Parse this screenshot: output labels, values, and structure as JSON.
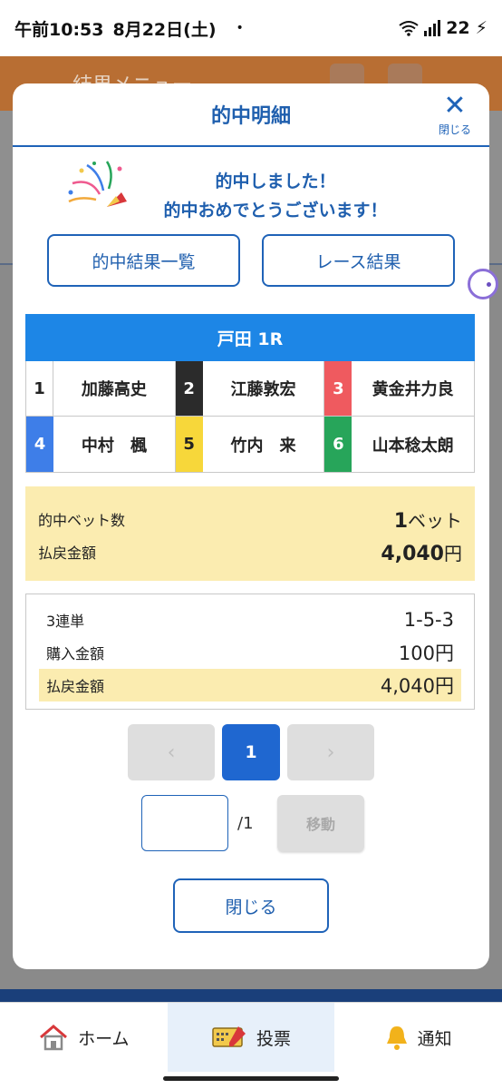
{
  "status_bar": {
    "time": "午前10:53",
    "date": "8月22日(土)",
    "dot": "•",
    "battery": "22"
  },
  "background": {
    "menu_title": "結果メニュー",
    "brand_color": "#b86e33"
  },
  "modal": {
    "title": "的中明細",
    "close_label": "閉じる",
    "close_glyph": "✕",
    "congrats_line1": "的中しました！",
    "congrats_line2": "的中おめでとうございます！",
    "btn_hit_list": "的中結果一覧",
    "btn_race_result": "レース結果",
    "race_name": "戸田 1R",
    "racers": [
      {
        "lane": "1",
        "name": "加藤高史",
        "lane_bg": "#ffffff",
        "lane_fg": "#222222"
      },
      {
        "lane": "2",
        "name": "江藤敦宏",
        "lane_bg": "#2b2b2b",
        "lane_fg": "#ffffff"
      },
      {
        "lane": "3",
        "name": "黄金井力良",
        "lane_bg": "#ef5a5f",
        "lane_fg": "#ffffff"
      },
      {
        "lane": "4",
        "name": "中村　楓",
        "lane_bg": "#3e7ee8",
        "lane_fg": "#ffffff"
      },
      {
        "lane": "5",
        "name": "竹内　来",
        "lane_bg": "#f7d73a",
        "lane_fg": "#222222"
      },
      {
        "lane": "6",
        "name": "山本稔太朗",
        "lane_bg": "#27a55a",
        "lane_fg": "#ffffff"
      }
    ],
    "hit_count_label": "的中ベット数",
    "hit_count_value": "1",
    "hit_count_unit": "ベット",
    "payout_label": "払戻金額",
    "payout_value": "4,040",
    "payout_unit": "円",
    "detail": {
      "bet_type": "3連単",
      "combination": "1-5-3",
      "purchase_label": "購入金額",
      "purchase_value": "100円",
      "payout_label": "払戻金額",
      "payout_value": "4,040円"
    },
    "pager": {
      "prev": "‹",
      "current": "1",
      "next": "›",
      "total": "/1",
      "move_label": "移動",
      "input_value": ""
    },
    "close_button": "閉じる"
  },
  "bottom_nav": {
    "home": "ホーム",
    "vote": "投票",
    "notify": "通知"
  }
}
